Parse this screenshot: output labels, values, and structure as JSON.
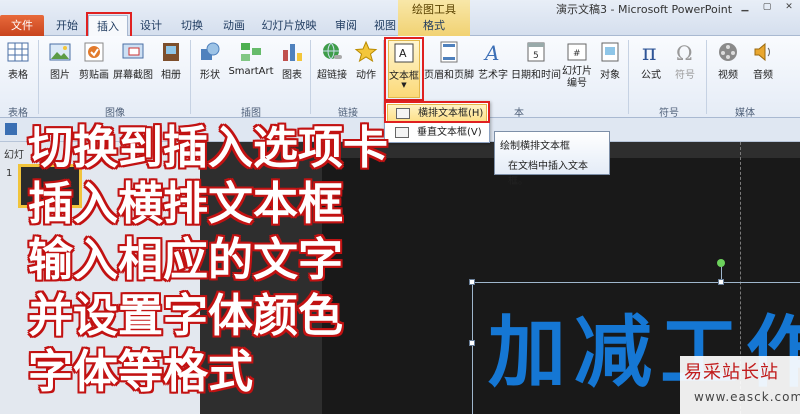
{
  "window": {
    "doc_title": "演示文稿3 - Microsoft PowerPoint",
    "contextual_tab_title": "绘图工具"
  },
  "tabs": [
    {
      "label": "文件"
    },
    {
      "label": "开始"
    },
    {
      "label": "插入"
    },
    {
      "label": "设计"
    },
    {
      "label": "切换"
    },
    {
      "label": "动画"
    },
    {
      "label": "幻灯片放映"
    },
    {
      "label": "审阅"
    },
    {
      "label": "视图"
    },
    {
      "label": "格式"
    }
  ],
  "ribbon": {
    "buttons": [
      {
        "label": "表格"
      },
      {
        "label": "图片"
      },
      {
        "label": "剪贴画"
      },
      {
        "label": "屏幕截图"
      },
      {
        "label": "相册"
      },
      {
        "label": "形状"
      },
      {
        "label": "SmartArt"
      },
      {
        "label": "图表"
      },
      {
        "label": "超链接"
      },
      {
        "label": "动作"
      },
      {
        "label": "文本框"
      },
      {
        "label": "页眉和页脚"
      },
      {
        "label": "艺术字"
      },
      {
        "label": "日期和时间"
      },
      {
        "label": "幻灯片编号"
      },
      {
        "label": "对象"
      },
      {
        "label": "公式"
      },
      {
        "label": "符号"
      },
      {
        "label": "视频"
      },
      {
        "label": "音频"
      }
    ],
    "groups": [
      {
        "label": "表格"
      },
      {
        "label": "图像"
      },
      {
        "label": "插图"
      },
      {
        "label": "链接"
      },
      {
        "label": "本"
      },
      {
        "label": "符号"
      },
      {
        "label": "媒体"
      }
    ]
  },
  "dropdown": {
    "items": [
      {
        "label": "横排文本框(H)"
      },
      {
        "label": "垂直文本框(V)"
      }
    ]
  },
  "tooltip": {
    "title": "绘制横排文本框",
    "description": "在文档中插入文本框。"
  },
  "left_pane": {
    "tab_label": "幻灯",
    "slide_number": "1"
  },
  "slide": {
    "text": "加减工作"
  },
  "overlay": {
    "lines": [
      "切换到插入选项卡",
      "插入横排文本框",
      "输入相应的文字",
      "并设置字体颜色",
      "字体等格式"
    ]
  },
  "watermark": {
    "url": "www.easck.com"
  },
  "colors": {
    "accent_red": "#e02020",
    "slide_text_blue": "#1577d4",
    "file_tab": "#c8441e"
  }
}
